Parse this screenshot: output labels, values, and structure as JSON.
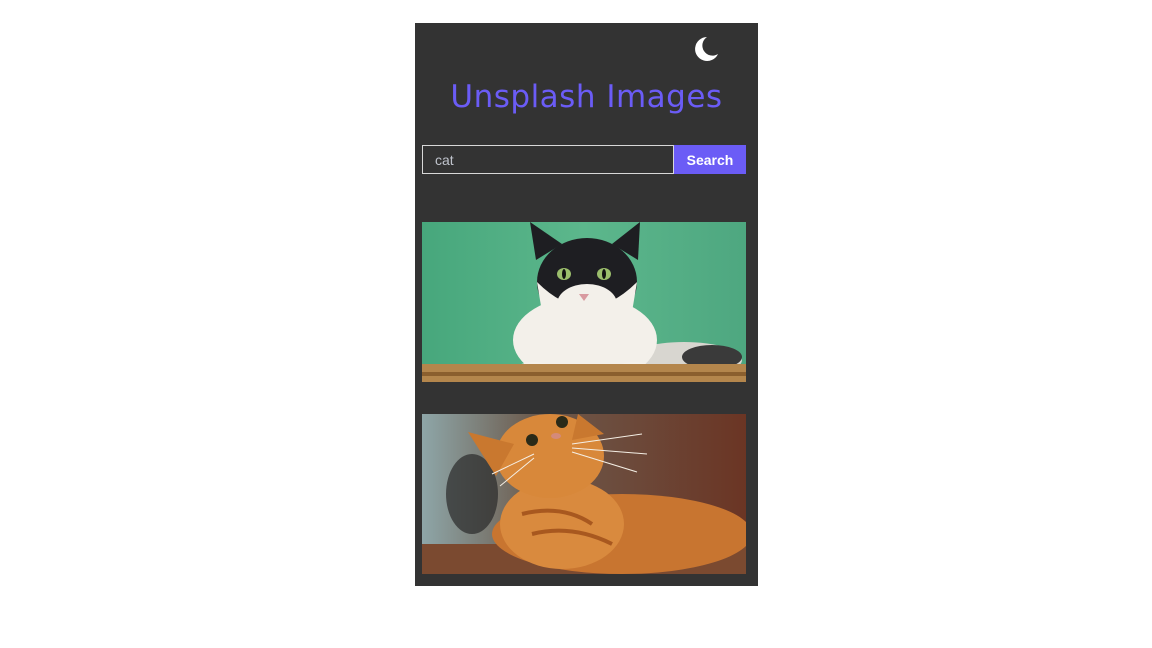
{
  "header": {
    "title": "Unsplash Images",
    "theme_icon": "moon-icon"
  },
  "search": {
    "value": "cat",
    "button_label": "Search"
  },
  "results": [
    {
      "description": "black-and-white-cat-on-green-background"
    },
    {
      "description": "orange-cat-looking-up"
    }
  ],
  "colors": {
    "accent": "#6b5cf6",
    "panel_background": "#333333",
    "page_background": "#ffffff"
  }
}
